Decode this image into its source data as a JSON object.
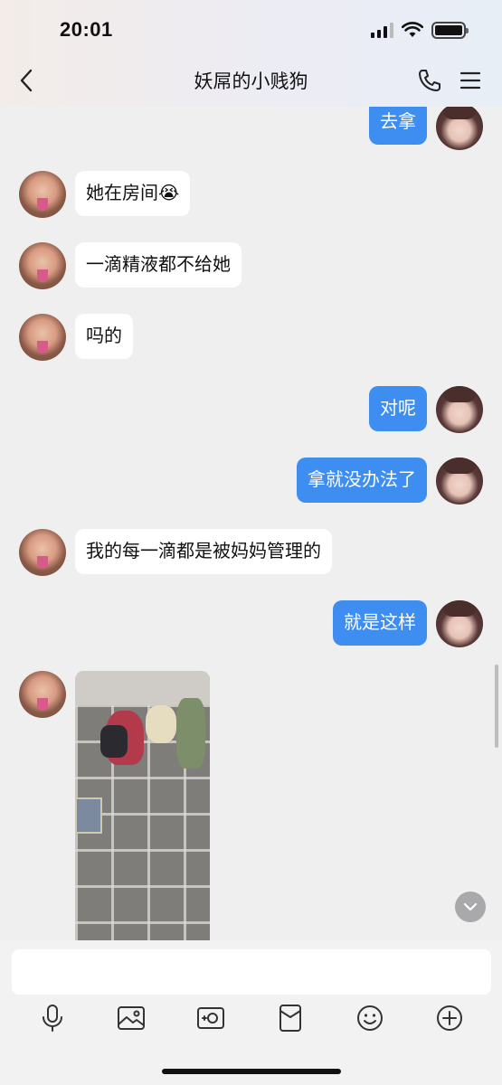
{
  "status_bar": {
    "time": "20:01"
  },
  "header": {
    "title": "妖屌的小贱狗"
  },
  "messages": [
    {
      "from": "me",
      "text": "去拿"
    },
    {
      "from": "other",
      "text": "她在房间😭"
    },
    {
      "from": "other",
      "text": "一滴精液都不给她"
    },
    {
      "from": "other",
      "text": "吗的"
    },
    {
      "from": "me",
      "text": "对呢"
    },
    {
      "from": "me",
      "text": "拿就没办法了"
    },
    {
      "from": "other",
      "text": "我的每一滴都是被妈妈管理的"
    },
    {
      "from": "me",
      "text": "就是这样"
    },
    {
      "from": "other",
      "type": "image"
    }
  ],
  "composer": {
    "input_value": ""
  },
  "toolbar_icons": [
    "microphone-icon",
    "image-icon",
    "camera-icon",
    "red-packet-icon",
    "emoji-icon",
    "plus-icon"
  ],
  "colors": {
    "me_bubble": "#3e8ef2",
    "other_bubble": "#ffffff",
    "background": "#efefef"
  }
}
